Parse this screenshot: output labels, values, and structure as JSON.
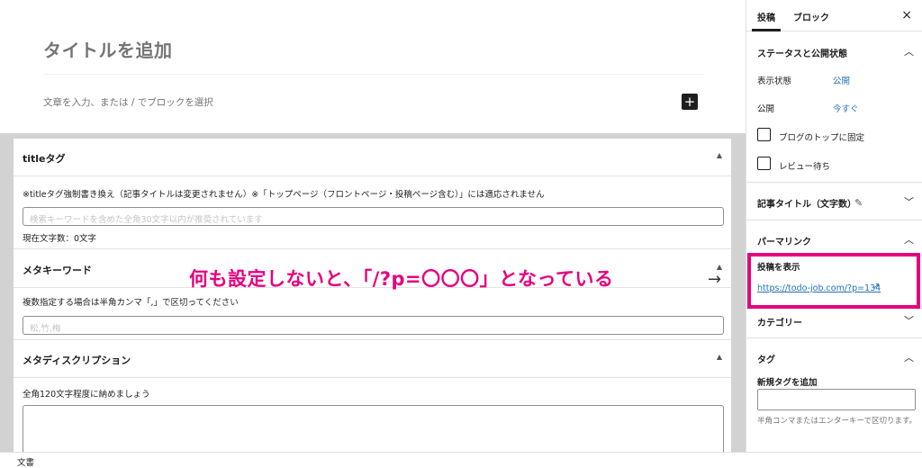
{
  "editor": {
    "title_placeholder": "タイトルを追加",
    "paragraph_placeholder": "文章を入力、または / でブロックを選択",
    "add_block": "+"
  },
  "meta": {
    "title_tag": {
      "heading": "titleタグ",
      "description": "※titleタグ強制書き換え（記事タイトルは変更されません）※「トップページ（フロントページ・投稿ページ含む）」には適応されません",
      "placeholder": "検索キーワードを含めた全角30文字以内が推奨されています",
      "counter": "現在文字数：0文字"
    },
    "keywords": {
      "heading": "メタキーワード",
      "description": "複数指定する場合は半角カンマ「,」で区切ってください",
      "placeholder": "松,竹,梅"
    },
    "description": {
      "heading": "メタディスクリプション",
      "description": "全角120文字程度に納めましょう"
    },
    "caret": "▲"
  },
  "annotation": {
    "text": "何も設定しないと、「/?p=〇〇〇」となっている",
    "arrow": "→",
    "color": "#e6007e"
  },
  "footer": {
    "breadcrumb": "文書"
  },
  "sidebar": {
    "tabs": [
      "投稿",
      "ブロック"
    ],
    "close": "×",
    "status": {
      "heading": "ステータスと公開状態",
      "visibility_label": "表示状態",
      "visibility_value": "公開",
      "publish_label": "公開",
      "publish_value": "今すぐ",
      "sticky_label": "ブログのトップに固定",
      "pending_label": "レビュー待ち"
    },
    "article_title": {
      "heading": "記事タイトル（文字数）"
    },
    "permalink": {
      "heading": "パーマリンク",
      "view_label": "投稿を表示",
      "url": "https://todo-job.com/?p=134"
    },
    "categories": {
      "heading": "カテゴリー"
    },
    "tags": {
      "heading": "タグ",
      "add_label": "新規タグを追加",
      "help": "半角コンマまたはエンターキーで区切ります。"
    }
  }
}
